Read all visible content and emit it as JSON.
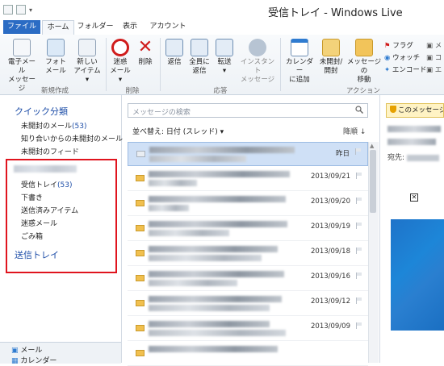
{
  "window": {
    "title": "受信トレイ - Windows Live"
  },
  "ribbon_tabs": [
    "ファイル",
    "ホーム",
    "フォルダー",
    "表示",
    "アカウント"
  ],
  "ribbon": {
    "groups": {
      "new": {
        "label": "新規作成",
        "buttons": [
          {
            "label1": "電子メール",
            "label2": "メッセージ",
            "icon": "email-message-icon"
          },
          {
            "label1": "フォト",
            "label2": "メール",
            "icon": "photo-mail-icon"
          },
          {
            "label1": "新しい",
            "label2": "アイテム ▾",
            "icon": "new-item-icon"
          }
        ]
      },
      "delete": {
        "label": "削除",
        "buttons": [
          {
            "label1": "迷惑",
            "label2": "メール ▾",
            "icon": "junk-icon"
          },
          {
            "label1": "削除",
            "label2": "",
            "icon": "delete-icon"
          }
        ]
      },
      "respond": {
        "label": "応答",
        "buttons": [
          {
            "label1": "返信",
            "label2": "",
            "icon": "reply-icon"
          },
          {
            "label1": "全員に",
            "label2": "返信",
            "icon": "reply-all-icon"
          },
          {
            "label1": "転送",
            "label2": "▾",
            "icon": "forward-icon"
          },
          {
            "label1": "インスタント",
            "label2": "メッセージ",
            "icon": "instant-message-icon"
          }
        ]
      },
      "actions": {
        "label": "アクション",
        "buttons": [
          {
            "label1": "カレンダー",
            "label2": "に追加",
            "icon": "calendar-add-icon"
          },
          {
            "label1": "未開封/",
            "label2": "開封",
            "icon": "unread-read-icon"
          },
          {
            "label1": "メッセージの",
            "label2": "移動",
            "icon": "move-message-icon"
          }
        ],
        "small": [
          {
            "label": "フラグ",
            "icon": "flag-icon"
          },
          {
            "label": "ウォッチ",
            "icon": "watch-icon"
          },
          {
            "label": "エンコード",
            "icon": "encode-icon"
          }
        ]
      }
    }
  },
  "left_pane": {
    "quick_title": "クイック分類",
    "quick_items": [
      {
        "label": "未開封のメール",
        "count": "(53)"
      },
      {
        "label": "知り合いからの未開封のメール",
        "count": ""
      },
      {
        "label": "未開封のフィード",
        "count": ""
      }
    ],
    "account_folders": [
      {
        "label": "受信トレイ",
        "count": "(53)"
      },
      {
        "label": "下書き",
        "count": ""
      },
      {
        "label": "送信済みアイテム",
        "count": ""
      },
      {
        "label": "迷惑メール",
        "count": ""
      },
      {
        "label": "ごみ箱",
        "count": ""
      }
    ],
    "outbox": "送信トレイ",
    "nav": [
      "メール",
      "カレンダー"
    ]
  },
  "message_list": {
    "search_placeholder": "メッセージの検索",
    "sort_label": "並べ替え: 日付 (スレッド) ▾",
    "sort_direction": "降順 ↓",
    "messages": [
      {
        "date": "昨日",
        "read": true,
        "selected": true
      },
      {
        "date": "2013/09/21",
        "read": false,
        "selected": false
      },
      {
        "date": "2013/09/20",
        "read": false,
        "selected": false
      },
      {
        "date": "2013/09/19",
        "read": false,
        "selected": false
      },
      {
        "date": "2013/09/18",
        "read": false,
        "selected": false
      },
      {
        "date": "2013/09/16",
        "read": false,
        "selected": false
      },
      {
        "date": "2013/09/12",
        "read": false,
        "selected": false
      },
      {
        "date": "2013/09/09",
        "read": false,
        "selected": false
      }
    ]
  },
  "reading_pane": {
    "warning": "このメッセージの",
    "to_label": "宛先:"
  },
  "colors": {
    "accent": "#2b6cc4",
    "link": "#1e4ea8",
    "highlight_box": "#e0141e",
    "selected_row": "#cfe0f6"
  }
}
